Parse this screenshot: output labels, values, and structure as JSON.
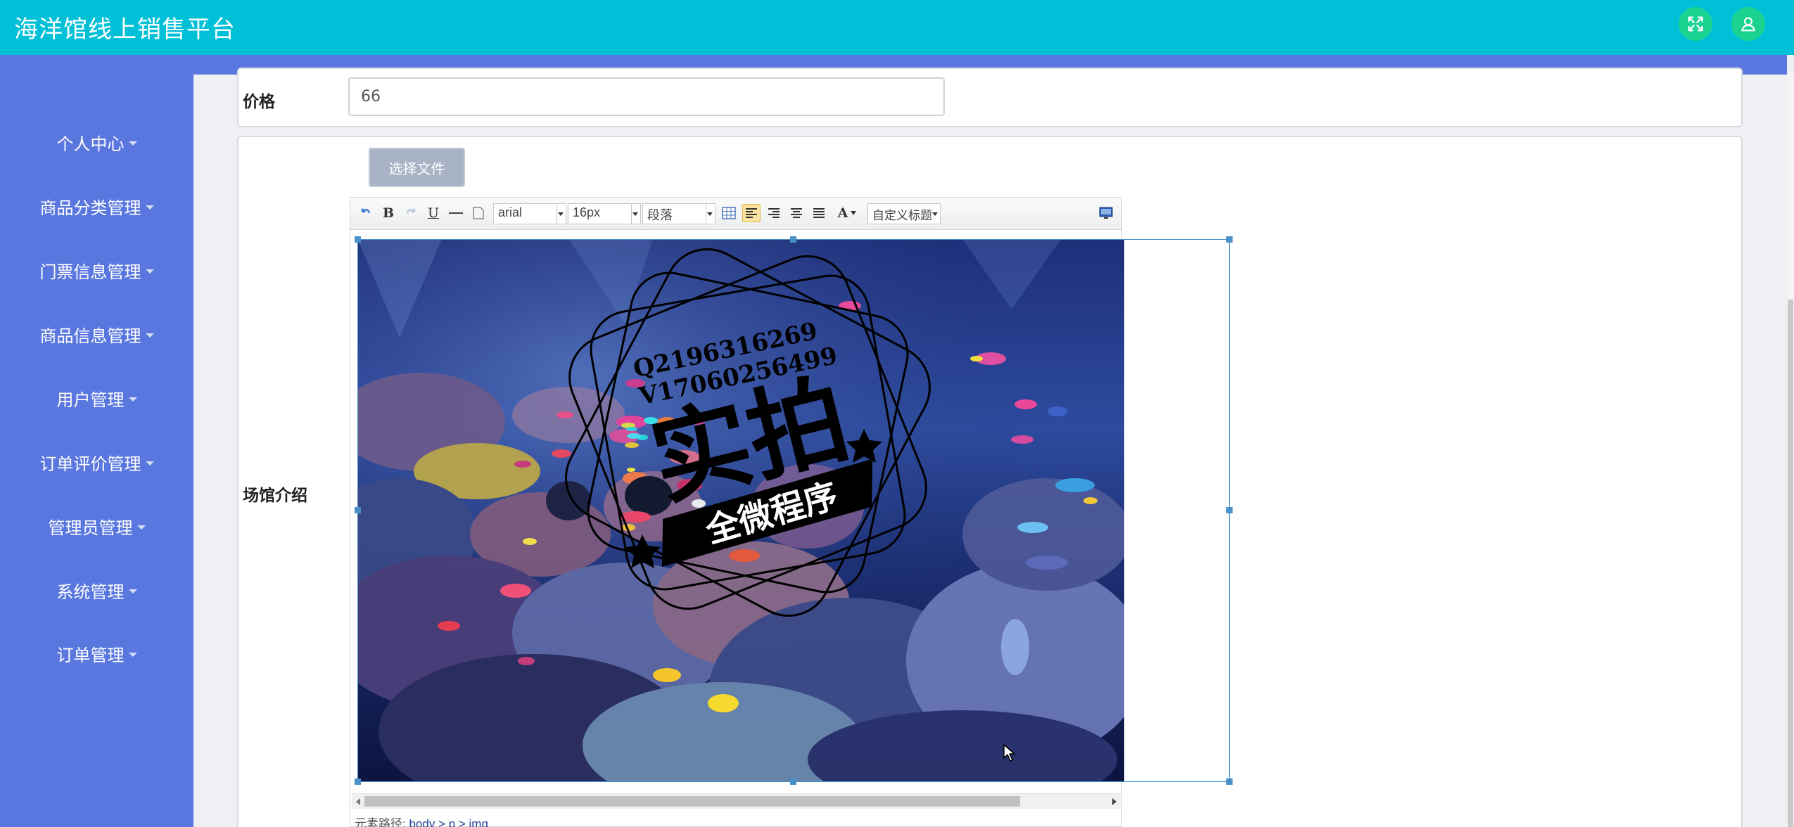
{
  "app": {
    "title": "海洋馆线上销售平台"
  },
  "header": {
    "fullscreen_icon": "expand-arrows-icon",
    "user_icon": "user-icon",
    "button_color": "#1bd391"
  },
  "sidebar": {
    "items": [
      {
        "label": "个人中心"
      },
      {
        "label": "商品分类管理"
      },
      {
        "label": "门票信息管理"
      },
      {
        "label": "商品信息管理"
      },
      {
        "label": "用户管理"
      },
      {
        "label": "订单评价管理"
      },
      {
        "label": "管理员管理"
      },
      {
        "label": "系统管理"
      },
      {
        "label": "订单管理"
      }
    ]
  },
  "form": {
    "price": {
      "label": "价格",
      "value": "66"
    },
    "intro": {
      "label": "场馆介绍",
      "file_button": "选择文件"
    }
  },
  "editor": {
    "toolbar": {
      "font_family": "arial",
      "font_size": "16px",
      "paragraph": "段落",
      "custom_title": "自定义标题",
      "font_color_glyph": "A"
    },
    "image": {
      "watermark_contact_1": "Q2196316269",
      "watermark_contact_2": "V17060256499",
      "watermark_big": "实拍",
      "watermark_banner": "全微程序"
    },
    "element_path_label": "元素路径:",
    "element_path_value": "body > p > img"
  },
  "colors": {
    "topbar": "#00c0d8",
    "sidebar": "#5977de",
    "accent": "#4a90c8"
  }
}
